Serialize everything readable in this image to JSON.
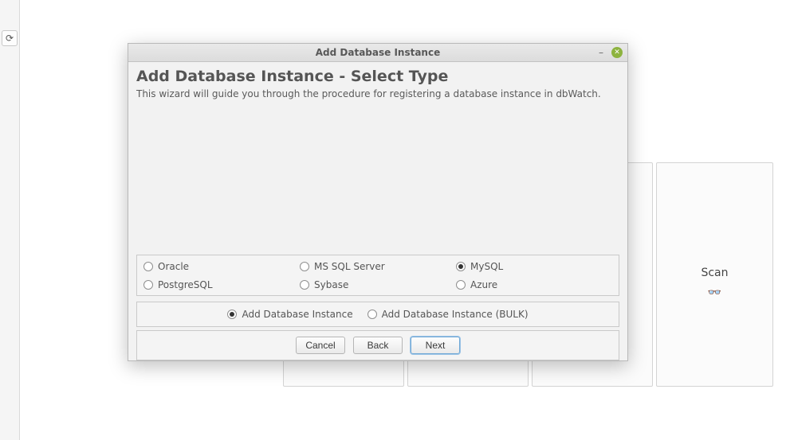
{
  "window": {
    "title": "Add Database Instance"
  },
  "header": {
    "title": "Add Database Instance - Select Type",
    "description": "This wizard will guide you through the procedure for registering a database instance in dbWatch."
  },
  "db_types": {
    "options": [
      {
        "id": "oracle",
        "label": "Oracle",
        "selected": false
      },
      {
        "id": "mssql",
        "label": "MS SQL Server",
        "selected": false
      },
      {
        "id": "mysql",
        "label": "MySQL",
        "selected": true
      },
      {
        "id": "postgresql",
        "label": "PostgreSQL",
        "selected": false
      },
      {
        "id": "sybase",
        "label": "Sybase",
        "selected": false
      },
      {
        "id": "azure",
        "label": "Azure",
        "selected": false
      }
    ]
  },
  "modes": {
    "options": [
      {
        "id": "single",
        "label": "Add Database Instance",
        "selected": true
      },
      {
        "id": "bulk",
        "label": "Add Database Instance (BULK)",
        "selected": false
      }
    ]
  },
  "buttons": {
    "cancel": "Cancel",
    "back": "Back",
    "next": "Next"
  },
  "background": {
    "refresh_glyph": "⟳",
    "scan_label": "Scan",
    "scan_glyph": "👓"
  }
}
